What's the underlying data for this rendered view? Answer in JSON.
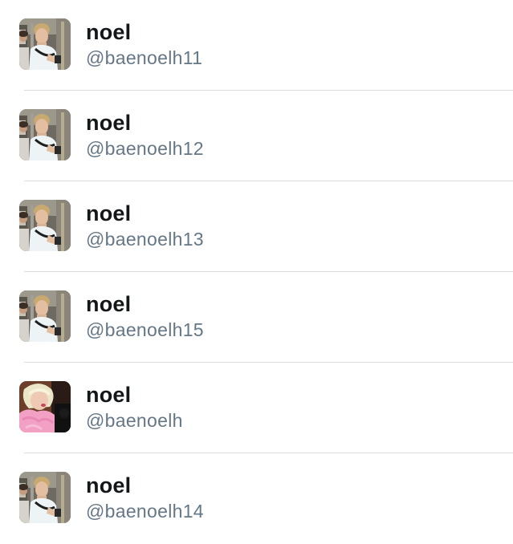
{
  "accounts": [
    {
      "display_name": "noel",
      "username": "@baenoelh11",
      "avatar": "subway-photo-avatar"
    },
    {
      "display_name": "noel",
      "username": "@baenoelh12",
      "avatar": "subway-photo-avatar"
    },
    {
      "display_name": "noel",
      "username": "@baenoelh13",
      "avatar": "subway-photo-avatar"
    },
    {
      "display_name": "noel",
      "username": "@baenoelh15",
      "avatar": "subway-photo-avatar"
    },
    {
      "display_name": "noel",
      "username": "@baenoelh",
      "avatar": "blonde-pink-coat-avatar"
    },
    {
      "display_name": "noel",
      "username": "@baenoelh14",
      "avatar": "subway-photo-avatar"
    }
  ],
  "colors": {
    "name_text": "#14171a",
    "username_text": "#657786",
    "divider": "#dcdcdc"
  }
}
